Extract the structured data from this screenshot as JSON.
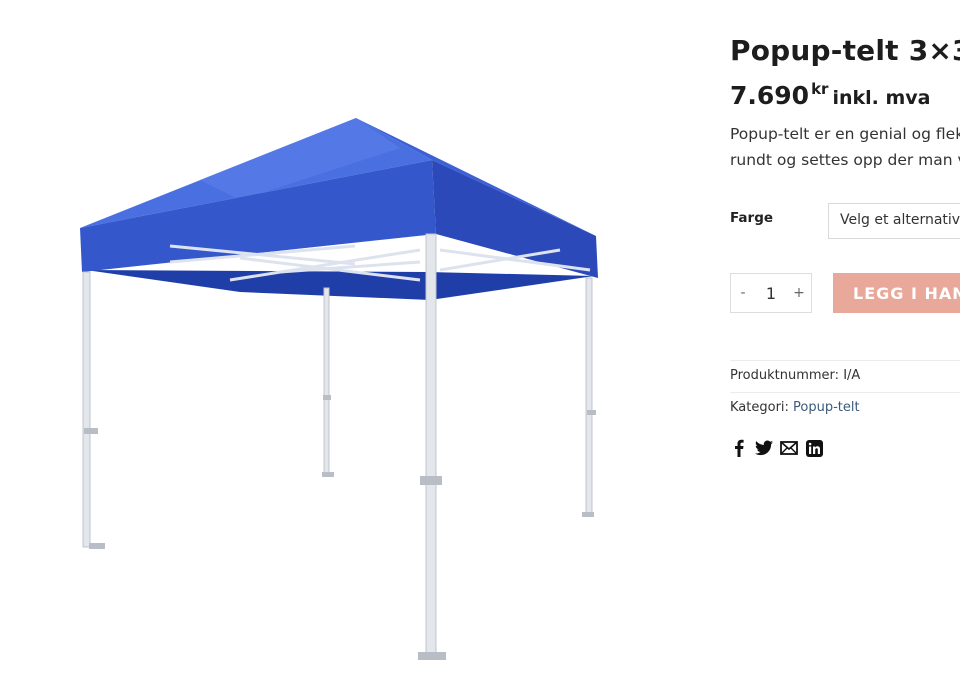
{
  "product": {
    "title": "Popup-telt 3×3 me",
    "price_amount": "7.690",
    "price_currency": "kr",
    "price_tax": "inkl. mva",
    "description_line1": "Popup-telt er en genial og fleks",
    "description_line2": "rundt og settes opp der man vil."
  },
  "variation": {
    "label": "Farge",
    "selected": "Velg et alternativ"
  },
  "cart": {
    "minus": "-",
    "quantity": "1",
    "plus": "+",
    "add_label": "LEGG I HAND"
  },
  "meta": {
    "sku_label": "Produktnummer:",
    "sku_value": "I/A",
    "category_label": "Kategori:",
    "category_value": "Popup-telt"
  },
  "share": [
    "facebook-icon",
    "twitter-icon",
    "email-icon",
    "linkedin-icon"
  ],
  "colors": {
    "canopy": "#3a5fd0",
    "button": "#e8a99a",
    "link": "#3b5a7a"
  }
}
